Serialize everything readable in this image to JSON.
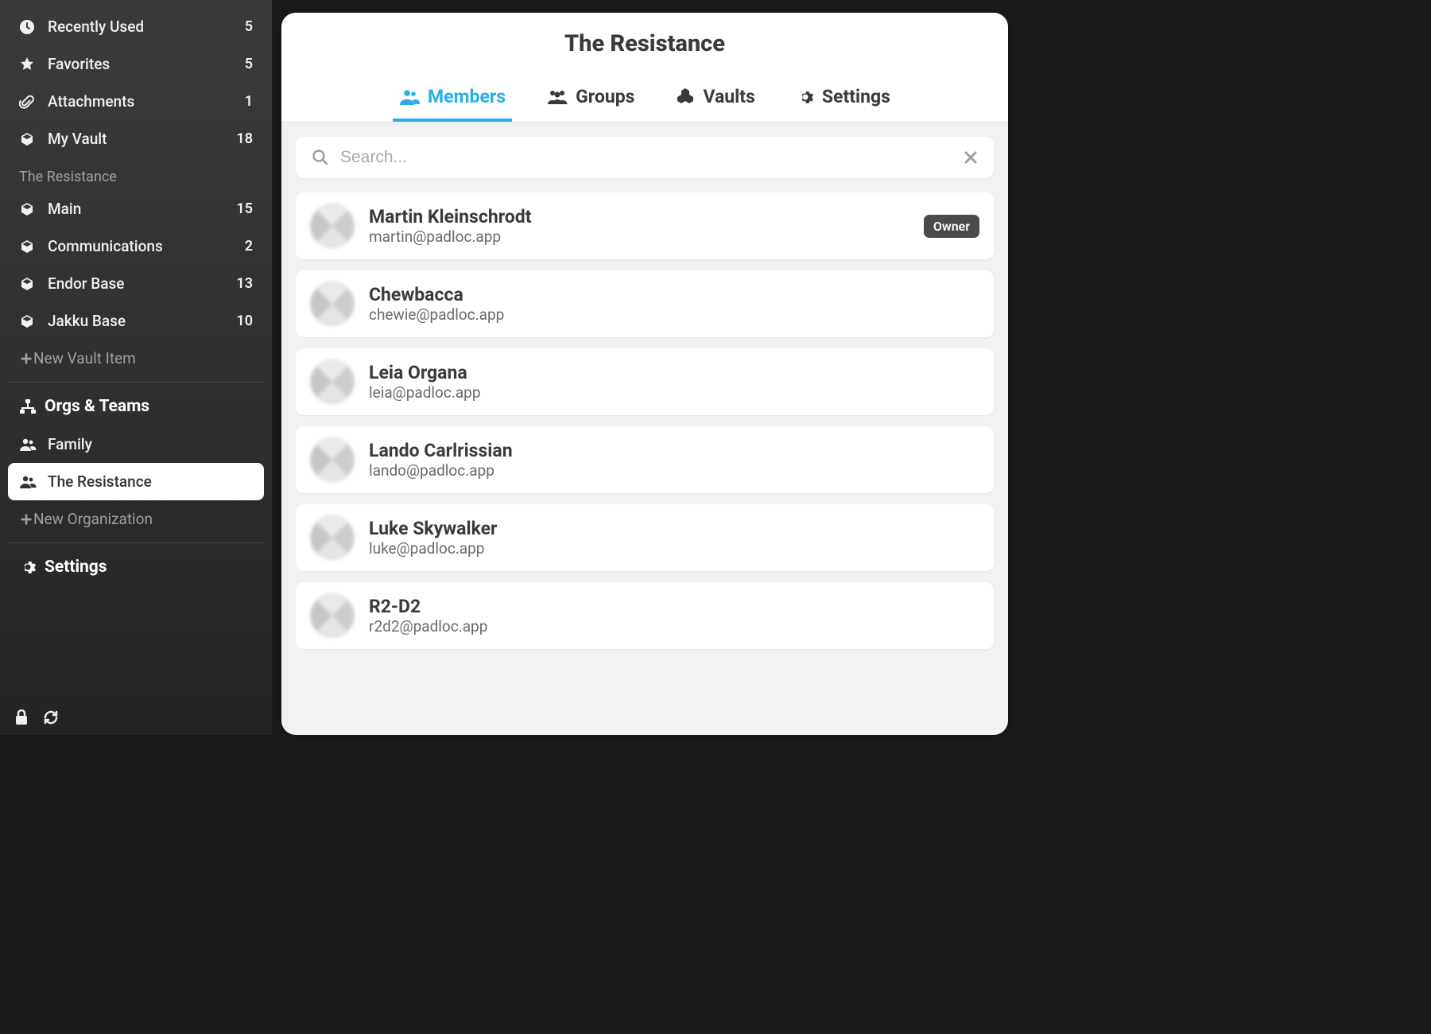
{
  "colors": {
    "accent": "#29aee6",
    "text_dark": "#3a3a3a"
  },
  "sidebar": {
    "nav": [
      {
        "id": "recently-used",
        "label": "Recently Used",
        "count": "5"
      },
      {
        "id": "favorites",
        "label": "Favorites",
        "count": "5"
      },
      {
        "id": "attachments",
        "label": "Attachments",
        "count": "1"
      },
      {
        "id": "my-vault",
        "label": "My Vault",
        "count": "18"
      }
    ],
    "org_section_label": "The Resistance",
    "vaults": [
      {
        "id": "main",
        "label": "Main",
        "count": "15"
      },
      {
        "id": "communications",
        "label": "Communications",
        "count": "2"
      },
      {
        "id": "endor-base",
        "label": "Endor Base",
        "count": "13"
      },
      {
        "id": "jakku-base",
        "label": "Jakku Base",
        "count": "10"
      }
    ],
    "new_vault_label": "New Vault Item",
    "orgs_heading": "Orgs & Teams",
    "orgs": [
      {
        "id": "family",
        "label": "Family",
        "active": false
      },
      {
        "id": "resistance",
        "label": "The Resistance",
        "active": true
      }
    ],
    "new_org_label": "New Organization",
    "settings_label": "Settings"
  },
  "main": {
    "title": "The Resistance",
    "tabs": [
      {
        "id": "members",
        "label": "Members"
      },
      {
        "id": "groups",
        "label": "Groups"
      },
      {
        "id": "vaults",
        "label": "Vaults"
      },
      {
        "id": "settings",
        "label": "Settings"
      }
    ],
    "active_tab": "members",
    "search": {
      "placeholder": "Search...",
      "value": ""
    },
    "members": [
      {
        "name": "Martin Kleinschrodt",
        "email": "martin@padloc.app",
        "badge": "Owner"
      },
      {
        "name": "Chewbacca",
        "email": "chewie@padloc.app",
        "badge": ""
      },
      {
        "name": "Leia Organa",
        "email": "leia@padloc.app",
        "badge": ""
      },
      {
        "name": "Lando Carlrissian",
        "email": "lando@padloc.app",
        "badge": ""
      },
      {
        "name": "Luke Skywalker",
        "email": "luke@padloc.app",
        "badge": ""
      },
      {
        "name": "R2-D2",
        "email": "r2d2@padloc.app",
        "badge": ""
      }
    ]
  }
}
